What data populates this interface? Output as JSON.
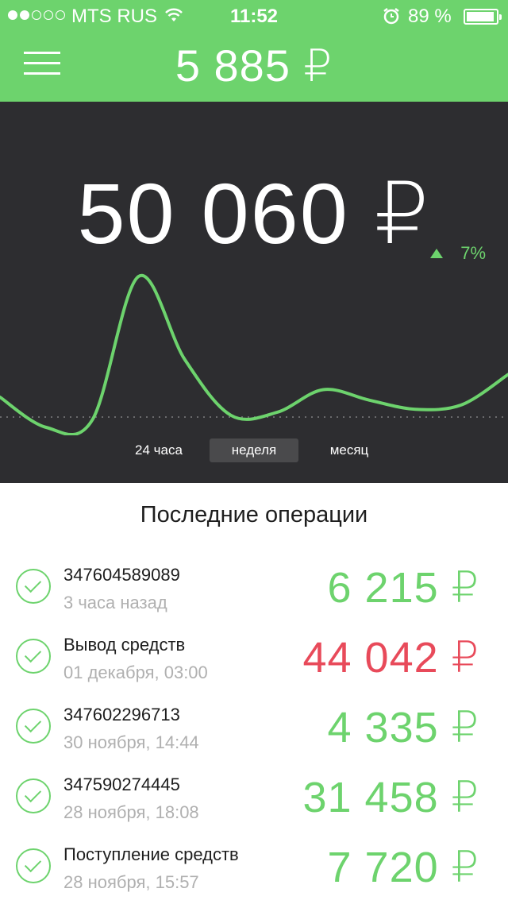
{
  "status": {
    "carrier": "MTS RUS",
    "time": "11:52",
    "battery_pct": "89 %"
  },
  "header": {
    "balance": "5 885 ₽"
  },
  "stats": {
    "amount": "50 060 ₽",
    "change": "7%"
  },
  "chart_data": {
    "type": "line",
    "series": [
      {
        "values": [
          0.2,
          0.0,
          0.05,
          1.0,
          0.45,
          0.08,
          0.1,
          0.25,
          0.18,
          0.12,
          0.15,
          0.35
        ]
      }
    ],
    "color": "#6dd36d"
  },
  "tabs": [
    {
      "label": "24 часа"
    },
    {
      "label": "неделя"
    },
    {
      "label": "месяц"
    }
  ],
  "operations": {
    "title": "Последние операции",
    "items": [
      {
        "title": "347604589089",
        "subtitle": "3 часа назад",
        "amount": "6 215 ₽",
        "color": "#6dd36d"
      },
      {
        "title": "Вывод средств",
        "subtitle": "01 декабря, 03:00",
        "amount": "44 042 ₽",
        "color": "#e84a5a"
      },
      {
        "title": "347602296713",
        "subtitle": "30 ноября, 14:44",
        "amount": "4 335 ₽",
        "color": "#6dd36d"
      },
      {
        "title": "347590274445",
        "subtitle": "28 ноября, 18:08",
        "amount": "31 458 ₽",
        "color": "#6dd36d"
      },
      {
        "title": "Поступление средств",
        "subtitle": "28 ноября, 15:57",
        "amount": "7 720 ₽",
        "color": "#6dd36d"
      }
    ]
  }
}
